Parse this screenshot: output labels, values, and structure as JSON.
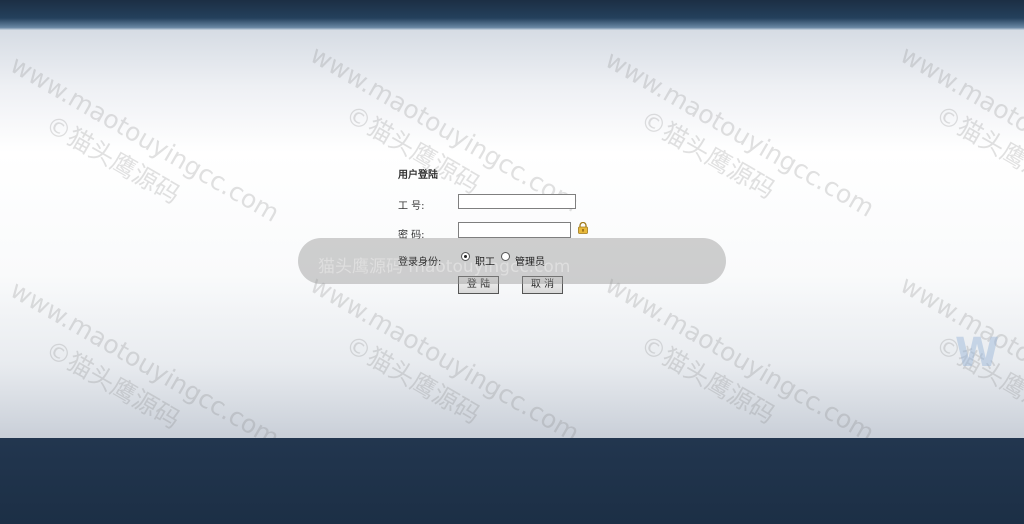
{
  "login": {
    "title": "用户登陆",
    "employee_id_label": "工 号:",
    "employee_id_value": "",
    "password_label": "密 码:",
    "password_value": "",
    "role_label": "登录身份:",
    "roles": [
      {
        "label": "职工",
        "checked": true
      },
      {
        "label": "管理员",
        "checked": false
      }
    ],
    "login_button": "登 陆",
    "cancel_button": "取 消"
  },
  "watermark": {
    "text_line1": "www.maotouyingcc.com",
    "text_line2": "©猫头鹰源码",
    "overlay_text": "猫头鹰源码 maotouyingcc.com"
  },
  "decoration": {
    "corner_letters": "W"
  },
  "colors": {
    "header": "#1c2e44",
    "footer": "#1e3148",
    "panel": "#f4f5f7"
  }
}
